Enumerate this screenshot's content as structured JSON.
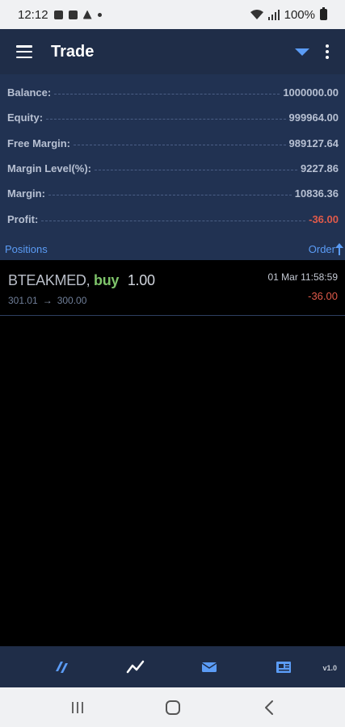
{
  "status_bar": {
    "time": "12:12",
    "battery": "100%"
  },
  "app_bar": {
    "title": "Trade"
  },
  "summary": [
    {
      "label": "Balance:",
      "value": "1000000.00",
      "negative": false
    },
    {
      "label": "Equity:",
      "value": "999964.00",
      "negative": false
    },
    {
      "label": "Free Margin:",
      "value": "989127.64",
      "negative": false
    },
    {
      "label": "Margin Level(%):",
      "value": "9227.86",
      "negative": false
    },
    {
      "label": "Margin:",
      "value": "10836.36",
      "negative": false
    },
    {
      "label": "Profit:",
      "value": "-36.00",
      "negative": true
    }
  ],
  "positions_header": {
    "positions_label": "Positions",
    "order_label": "Order"
  },
  "position": {
    "symbol": "BTEAKMED,",
    "side": "buy",
    "volume": "1.00",
    "open_price": "301.01",
    "current_price": "300.00",
    "time": "01 Mar 11:58:59",
    "profit": "-36.00"
  },
  "bottom_nav": {
    "version": "v1.0",
    "items": [
      {
        "name": "quotes",
        "icon": "quotes-icon"
      },
      {
        "name": "chart",
        "icon": "chart-line-icon"
      },
      {
        "name": "mail",
        "icon": "mail-icon"
      },
      {
        "name": "news",
        "icon": "news-icon"
      }
    ]
  },
  "colors": {
    "accent": "#5b9cf6",
    "header_bg": "#1f2d48",
    "summary_bg": "#213252",
    "negative": "#e05a4a",
    "buy": "#7ec46a"
  }
}
